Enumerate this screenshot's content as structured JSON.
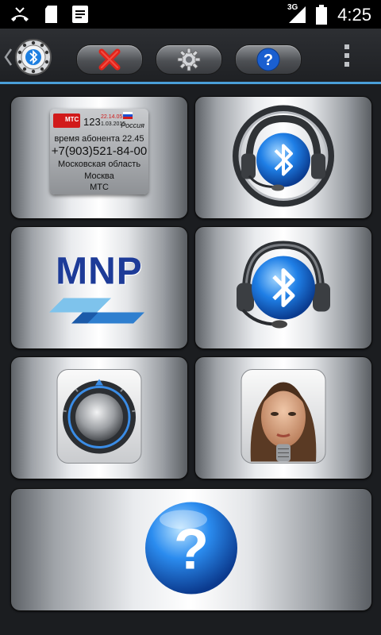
{
  "statusbar": {
    "time": "4:25",
    "network": "3G",
    "icons": [
      "missed-call-icon",
      "sd-card-icon",
      "notes-icon",
      "signal-icon",
      "battery-icon"
    ]
  },
  "toolbar": {
    "app_icon": "bluetooth-rotary-phone-icon",
    "close_icon": "close-icon",
    "settings_icon": "gear-icon",
    "help_icon": "help-icon",
    "overflow_icon": "overflow-menu-icon"
  },
  "tiles": {
    "operator_card": {
      "operator": "МТС",
      "short_number": "123",
      "date1": "22.14.05",
      "date2": "1.03.2015",
      "country": "Россия",
      "time_line": "время абонента 22.45",
      "phone": "+7(903)521-84-00",
      "region": "Московская область",
      "city": "Москва",
      "carrier": "МТС"
    },
    "mnp": {
      "label": "MNP"
    },
    "headset_ring": {
      "icon": "bluetooth-headset-steering-icon"
    },
    "headset": {
      "icon": "bluetooth-headset-icon"
    },
    "knob": {
      "icon": "volume-knob-icon"
    },
    "voice": {
      "icon": "voice-assistant-face-icon"
    },
    "help": {
      "icon": "help-sphere-icon"
    }
  },
  "colors": {
    "accent": "#4a9fd8",
    "mnp_blue": "#1d3b98",
    "close_red": "#e0241b"
  }
}
